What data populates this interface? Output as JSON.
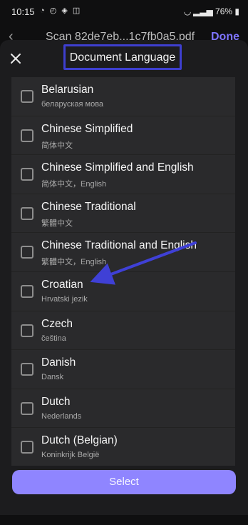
{
  "status": {
    "time": "10:15",
    "left_icons": "◔ ◴ ◈ ◫",
    "right_text": "76%"
  },
  "background": {
    "file_name": "Scan 82de7eb...1c7fb0a5.pdf",
    "done": "Done"
  },
  "header": {
    "title": "Document Language"
  },
  "languages": [
    {
      "title": "Belarusian",
      "sub": "беларуская мова"
    },
    {
      "title": "Chinese Simplified",
      "sub": "简体中文"
    },
    {
      "title": "Chinese Simplified and English",
      "sub": "简体中文，English"
    },
    {
      "title": "Chinese Traditional",
      "sub": "繁體中文"
    },
    {
      "title": "Chinese Traditional and English",
      "sub": "繁體中文，English"
    },
    {
      "title": "Croatian",
      "sub": "Hrvatski jezik"
    },
    {
      "title": "Czech",
      "sub": "čeština"
    },
    {
      "title": "Danish",
      "sub": "Dansk"
    },
    {
      "title": "Dutch",
      "sub": "Nederlands"
    },
    {
      "title": "Dutch (Belgian)",
      "sub": "Koninkrijk België"
    }
  ],
  "actions": {
    "select_label": "Select"
  },
  "colors": {
    "accent": "#8f85ff",
    "highlight_box": "#3e3fcf",
    "annotation_arrow": "#3f40d6"
  }
}
